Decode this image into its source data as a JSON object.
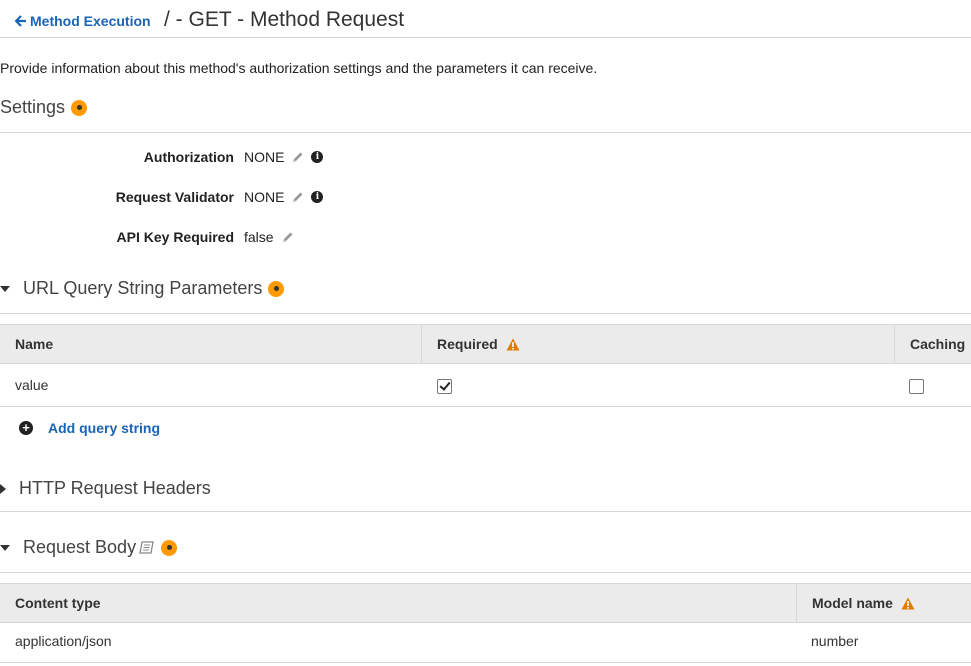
{
  "header": {
    "back_label": "Method Execution",
    "title": "/ - GET - Method Request"
  },
  "description": "Provide information about this method's authorization settings and the parameters it can receive.",
  "settings": {
    "title": "Settings",
    "rows": [
      {
        "label": "Authorization",
        "value": "NONE"
      },
      {
        "label": "Request Validator",
        "value": "NONE"
      },
      {
        "label": "API Key Required",
        "value": "false"
      }
    ]
  },
  "query_params": {
    "title": "URL Query String Parameters",
    "columns": {
      "name": "Name",
      "required": "Required",
      "caching": "Caching"
    },
    "rows": [
      {
        "name": "value",
        "required": true,
        "caching": false
      }
    ],
    "add_label": "Add query string"
  },
  "http_headers": {
    "title": "HTTP Request Headers"
  },
  "request_body": {
    "title": "Request Body",
    "columns": {
      "content_type": "Content type",
      "model_name": "Model name"
    },
    "rows": [
      {
        "content_type": "application/json",
        "model_name": "number"
      }
    ]
  },
  "colors": {
    "link": "#1a64b6",
    "accent": "#ff9900",
    "warning": "#e07b00"
  },
  "icons": [
    "back-arrow-icon",
    "info-dot-icon",
    "pencil-icon",
    "info-icon",
    "caret-down-icon",
    "caret-right-icon",
    "warning-icon",
    "checkbox-icon",
    "plus-circle-icon",
    "book-icon"
  ]
}
